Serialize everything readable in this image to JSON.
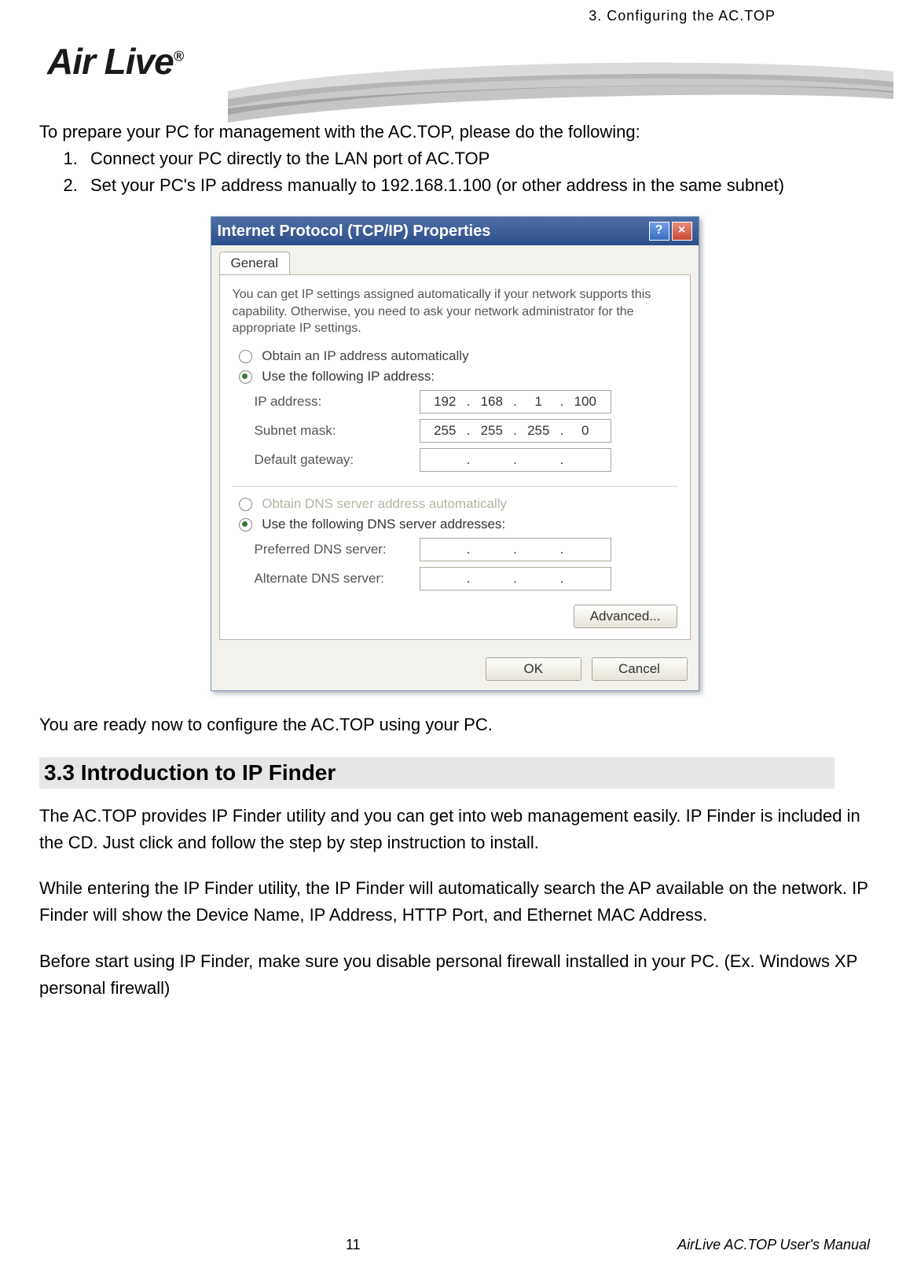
{
  "header": {
    "chapter": "3. Configuring the AC.TOP",
    "logo": "Air Live",
    "logo_reg": "®"
  },
  "intro": "To prepare your PC for management with the AC.TOP, please do the following:",
  "steps": [
    "Connect your PC directly to the LAN port of AC.TOP",
    "Set your PC's IP address manually to 192.168.1.100 (or other address in the same subnet)"
  ],
  "dialog": {
    "title": "Internet Protocol (TCP/IP) Properties",
    "help": "?",
    "close": "×",
    "tab": "General",
    "desc": "You can get IP settings assigned automatically if your network supports this capability. Otherwise, you need to ask your network administrator for the appropriate IP settings.",
    "radio_auto_ip": "Obtain an IP address automatically",
    "radio_use_ip": "Use the following IP address:",
    "ip_label": "IP address:",
    "ip_value": [
      "192",
      "168",
      "1",
      "100"
    ],
    "subnet_label": "Subnet mask:",
    "subnet_value": [
      "255",
      "255",
      "255",
      "0"
    ],
    "gateway_label": "Default gateway:",
    "gateway_value": [
      "",
      "",
      "",
      ""
    ],
    "radio_auto_dns": "Obtain DNS server address automatically",
    "radio_use_dns": "Use the following DNS server addresses:",
    "pref_dns_label": "Preferred DNS server:",
    "pref_dns_value": [
      "",
      "",
      "",
      ""
    ],
    "alt_dns_label": "Alternate DNS server:",
    "alt_dns_value": [
      "",
      "",
      "",
      ""
    ],
    "advanced_btn": "Advanced...",
    "ok_btn": "OK",
    "cancel_btn": "Cancel"
  },
  "after_dialog": "You are ready now to configure the AC.TOP using your PC.",
  "section_heading": "3.3 Introduction to IP Finder",
  "para1": "The AC.TOP provides IP Finder utility and you can get into web management easily. IP Finder is included in the CD. Just click and follow the step by step instruction to install.",
  "para2": "While entering the IP Finder utility, the IP Finder will automatically search the AP available on the network. IP Finder will show the Device Name, IP Address, HTTP Port, and Ethernet MAC Address.",
  "para3": "Before start using IP Finder, make sure you disable personal firewall installed in your PC. (Ex. Windows XP personal firewall)",
  "footer": {
    "page": "11",
    "manual": "AirLive AC.TOP User's Manual"
  }
}
